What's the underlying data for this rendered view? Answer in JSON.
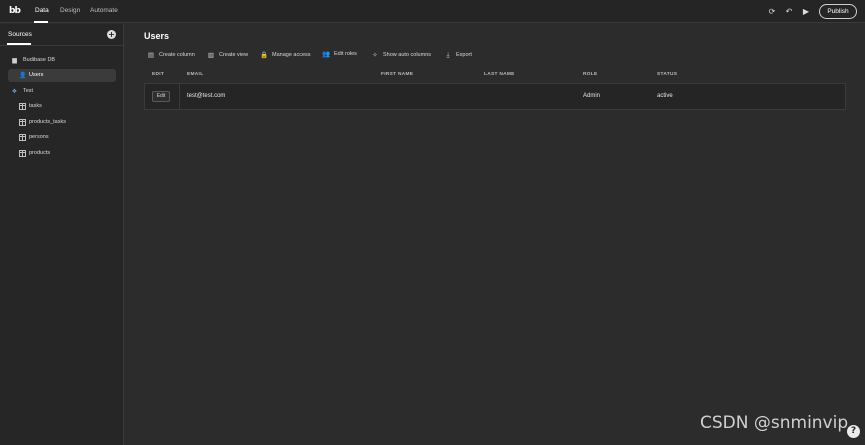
{
  "nav": {
    "logo": "bb",
    "tabs": [
      {
        "label": "Data",
        "active": true
      },
      {
        "label": "Design",
        "active": false
      },
      {
        "label": "Automate",
        "active": false
      }
    ],
    "icons": [
      "refresh-icon",
      "undo-icon",
      "play-icon"
    ],
    "publish_label": "Publish"
  },
  "sidebar": {
    "tab_label": "Sources",
    "add_icon": "plus-circle-icon",
    "items": [
      {
        "label": "Budibase DB",
        "icon": "database-icon"
      },
      {
        "label": "Users",
        "icon": "users-icon",
        "selected": true
      },
      {
        "label": "Test",
        "icon": "postgres-icon"
      },
      {
        "label": "tasks",
        "icon": "table-icon"
      },
      {
        "label": "products_tasks",
        "icon": "table-icon"
      },
      {
        "label": "persons",
        "icon": "table-icon"
      },
      {
        "label": "products",
        "icon": "table-icon"
      }
    ]
  },
  "main": {
    "title": "Users",
    "toolbar": [
      {
        "label": "Create column",
        "icon": "add-column-icon"
      },
      {
        "label": "Create view",
        "icon": "add-view-icon"
      },
      {
        "label": "Manage access",
        "icon": "lock-icon"
      },
      {
        "label": "Edit roles",
        "icon": "user-roles-icon"
      },
      {
        "label": "Show auto columns",
        "icon": "magic-wand-icon"
      },
      {
        "label": "Export",
        "icon": "download-icon"
      }
    ],
    "columns": [
      "EDIT",
      "EMAIL",
      "FIRST NAME",
      "LAST NAME",
      "ROLE",
      "STATUS"
    ],
    "rows": [
      {
        "edit": "Edit",
        "email": "test@test.com",
        "first_name": "",
        "last_name": "",
        "role": "Admin",
        "status": "active"
      }
    ]
  },
  "watermark": "CSDN @snminvip",
  "help_label": "?",
  "colors": {
    "background": "#2c2c2c",
    "sidebar": "#262626",
    "topbar": "#252525",
    "accent": "#ffffff"
  }
}
